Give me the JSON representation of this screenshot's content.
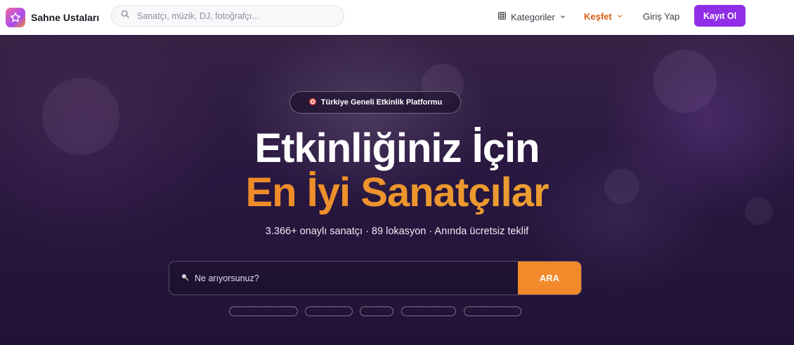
{
  "header": {
    "logo_text": "Sahne Ustaları",
    "search_placeholder": "Sanatçı, müzik, DJ, fotoğrafçı...",
    "nav": {
      "categories": "Kategoriler",
      "explore": "Keşfet",
      "login": "Giriş Yap",
      "signup": "Kayıt Ol"
    }
  },
  "hero": {
    "badge": "Türkiye Geneli Etkinlik Platformu",
    "title_line1": "Etkinliğiniz İçin",
    "title_line2": "En İyi Sanatçılar",
    "subtitle": "3.366+ onaylı sanatçı · 89 lokasyon · Anında ücretsiz teklif",
    "search_placeholder": "Ne arıyorsunuz?",
    "search_button": "ARA"
  },
  "colors": {
    "accent_purple": "#8f2ee6",
    "accent_orange": "#f2892a",
    "explore_text": "#dc5a14"
  },
  "icons": {
    "logo": "star-icon",
    "search": "search-icon",
    "categories": "grid-icon",
    "dropdown": "chevron-down-icon",
    "badge": "target-icon",
    "hero_search": "magnifier-icon"
  }
}
